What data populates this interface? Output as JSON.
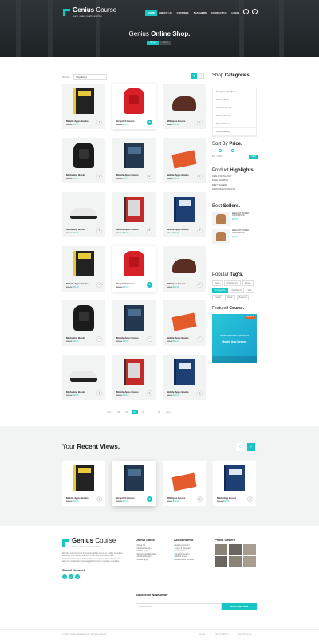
{
  "header": {
    "brand_bold": "Genius",
    "brand_rest": " Course",
    "tagline": "learn, share, teach, and live",
    "nav": [
      "HOME",
      "ABOUT US",
      "COURSES",
      "TEACHERS",
      "CONTACT US",
      "LOGIN"
    ],
    "hero_light": "Genius ",
    "hero_bold": "Online Shop.",
    "crumbs": [
      "Home",
      "Shop"
    ]
  },
  "shop": {
    "sort_label": "Sort by",
    "sort_value": "Popularity",
    "products": [
      {
        "name": "Mobile Apps Books",
        "price": "$80.00",
        "sale": "$60.00",
        "art": "book-y"
      },
      {
        "name": "Graprich Books",
        "price": "$80.00",
        "sale": "$60.00",
        "art": "bag-r"
      },
      {
        "name": "IOS Apps Books",
        "price": "$80.00",
        "sale": "$60.00",
        "art": "shoe-br"
      },
      {
        "name": "Marketing Books",
        "price": "$80.00",
        "sale": "$60.00",
        "art": "bag-b"
      },
      {
        "name": "Mobile Apps Books",
        "price": "$80.00",
        "sale": "$60.00",
        "art": "book-b"
      },
      {
        "name": "Mobile Apps Books",
        "price": "$80.00",
        "sale": "$60.00",
        "art": "book-o"
      },
      {
        "name": "Marketing Books",
        "price": "$80.00",
        "sale": "$60.00",
        "art": "shoe-w"
      },
      {
        "name": "Mobile Apps Books",
        "price": "$80.00",
        "sale": "$60.00",
        "art": "book-r"
      },
      {
        "name": "Mobile Apps Books",
        "price": "$80.00",
        "sale": "$60.00",
        "art": "book-n"
      },
      {
        "name": "Mobile Apps Books",
        "price": "$80.00",
        "sale": "$60.00",
        "art": "book-y"
      },
      {
        "name": "Graprich Books",
        "price": "$80.00",
        "sale": "$60.00",
        "art": "bag-r"
      },
      {
        "name": "IOS Apps Books",
        "price": "$80.00",
        "sale": "$60.00",
        "art": "shoe-br"
      },
      {
        "name": "Marketing Books",
        "price": "$80.00",
        "sale": "$60.00",
        "art": "bag-b"
      },
      {
        "name": "Mobile Apps Books",
        "price": "$80.00",
        "sale": "$60.00",
        "art": "book-b"
      },
      {
        "name": "Mobile Apps Books",
        "price": "$80.00",
        "sale": "$60.00",
        "art": "book-o"
      },
      {
        "name": "Marketing Books",
        "price": "$80.00",
        "sale": "$60.00",
        "art": "shoe-w"
      },
      {
        "name": "Mobile Apps Books",
        "price": "$80.00",
        "sale": "$60.00",
        "art": "book-r"
      },
      {
        "name": "Mobile Apps Books",
        "price": "$80.00",
        "sale": "$60.00",
        "art": "book-n"
      }
    ],
    "highlighted_index": [
      1,
      10
    ],
    "pagination": [
      "prev",
      "01",
      "02",
      "03",
      "04",
      "...",
      "10",
      "next"
    ],
    "current_page": "03"
  },
  "sidebar": {
    "categories_light": "Shop ",
    "categories_bold": "Categories.",
    "categories": [
      "Design/Graphic Book",
      "Student Bag's",
      "Education T-shirt",
      "Student Pencil's",
      "Tutorial Videos",
      "Other Products"
    ],
    "sort_light": "Sort By ",
    "sort_bold": "Price.",
    "range_text": "$10 - $100",
    "filter_label": "Filter",
    "highlights_light": "Product ",
    "highlights_bold": "Highlights.",
    "highlights": [
      "Deals of the day",
      "Free shipping",
      "Best sellers",
      "Featured products"
    ],
    "sellers_light": "Best ",
    "sellers_bold": "Sellers.",
    "sellers": [
      {
        "name": "ELEGANT WOMEN CONVERSE'S",
        "price": "$75.00"
      },
      {
        "name": "ELEGANT WOMEN CONVERSE'S",
        "price": "$75.00"
      }
    ],
    "tags_light": "Popular ",
    "tags_bold": "Tag's.",
    "tags": [
      "Design",
      "Programming",
      "Fitness",
      "Photography",
      "Illustrations",
      "Web",
      "Graphic",
      "Music",
      "Business"
    ],
    "active_tag": "Photography",
    "featured_light": "Featured ",
    "featured_bold": "Course.",
    "featured_badge": "PRICE $",
    "featured_line1": "Mobile Application Experiences",
    "featured_line2": "Mobile App Design."
  },
  "recent": {
    "title_light": "Your ",
    "title_bold": "Recent Views.",
    "items": [
      {
        "name": "Mobile Apps Books",
        "price": "$80.00",
        "sale": "$60.00",
        "art": "book-y"
      },
      {
        "name": "Graprich Books",
        "price": "$80.00",
        "sale": "$60.00",
        "art": "book-b"
      },
      {
        "name": "IOS Apps Books",
        "price": "$80.00",
        "sale": "$60.00",
        "art": "book-o"
      },
      {
        "name": "Marketing Books",
        "price": "$80.00",
        "sale": "$60.00",
        "art": "book-n"
      }
    ]
  },
  "footer": {
    "about": "We take our mission of increasing global access to quality education seriously. We connect learners to the best universities and institutions from around the world. Lorem ipsum dolor sit amet we take our mission of increasing global access to quality education.",
    "social_heading": "Social Network",
    "useful_heading": "Useful Links",
    "useful_links": [
      "About Us",
      "Graphic Design",
      "Mobile Apps",
      "Responsive Website",
      "Graphic Design",
      "Mobile Apps"
    ],
    "account_heading": "Account Info",
    "account_links": [
      "Setting Account",
      "Login & Register",
      "Contact Us",
      "Graphic Design",
      "Mobile Apps",
      "Responsive Website"
    ],
    "gallery_heading": "Photo Gallery",
    "newsletter_heading": "Subscribe Newsletter",
    "newsletter_placeholder": "Email Address",
    "newsletter_button": "SUBSCRIBE NOW",
    "copyright": "© 2019 - Genius Education.com - All rights reserved.",
    "bottom_links": [
      "Licence",
      "Privacy & Policy",
      "Term Of Service"
    ]
  }
}
